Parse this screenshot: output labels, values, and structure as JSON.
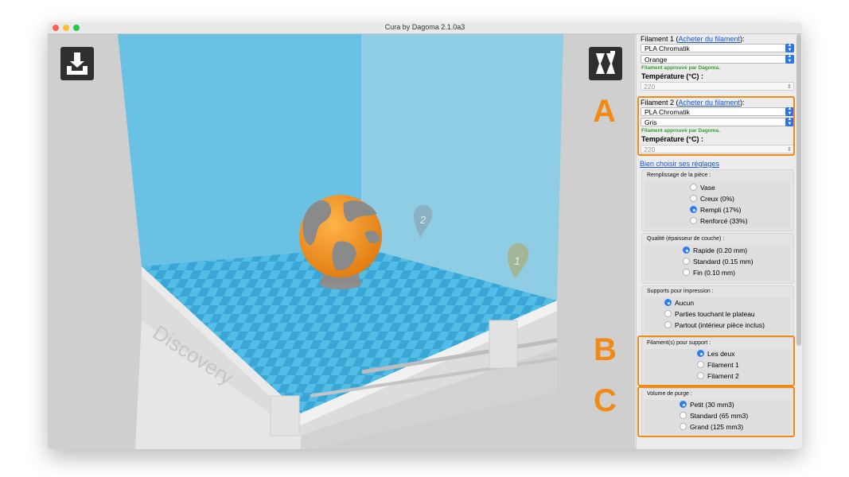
{
  "window": {
    "title": "Cura by Dagoma 2.1.0a3"
  },
  "viewport": {
    "bed_text": "Discovery",
    "markers": [
      "1",
      "2"
    ]
  },
  "filament1": {
    "label": "Filament  1 (",
    "buy_link": "Acheter du filament",
    "label_end": "):",
    "material": "PLA Chromatik",
    "color": "Orange",
    "approved": "Filament approuvé par Dagoma.",
    "temp_label": "Température (°C) :",
    "temp_value": "220"
  },
  "filament2": {
    "label": "Filament  2 (",
    "buy_link": "Acheter du filament",
    "label_end": "):",
    "material": "PLA Chromatik",
    "color": "Gris",
    "approved": "Filament approuvé par Dagoma.",
    "temp_label": "Température (°C) :",
    "temp_value": "220"
  },
  "settings_link": "Bien choisir ses réglages",
  "infill": {
    "title": "Remplissage de la pièce :",
    "options": [
      "Vase",
      "Creux (0%)",
      "Rempli (17%)",
      "Renforcé (33%)"
    ],
    "selected": "Rempli (17%)"
  },
  "quality": {
    "title": "Qualité (épaisseur de couche) :",
    "options": [
      "Rapide (0.20 mm)",
      "Standard (0.15 mm)",
      "Fin (0.10 mm)"
    ],
    "selected": "Rapide (0.20 mm)"
  },
  "supports": {
    "title": "Supports pour impression :",
    "options": [
      "Aucun",
      "Parties touchant le plateau",
      "Partout (intérieur pièce inclus)"
    ],
    "selected": "Aucun"
  },
  "support_filament": {
    "title": "Filament(s) pour support :",
    "options": [
      "Les deux",
      "Filament 1",
      "Filament 2"
    ],
    "selected": "Les deux"
  },
  "purge": {
    "title": "Volume de purge :",
    "options": [
      "Petit (30 mm3)",
      "Standard (65 mm3)",
      "Grand (125 mm3)"
    ],
    "selected": "Petit (30 mm3)"
  },
  "annotations": [
    "A",
    "B",
    "C"
  ],
  "colors": {
    "accent": "#f28a17",
    "link": "#1a55d8",
    "approved": "#3a9b36",
    "radio_selected": "#2e7cf6",
    "bed": "#4ab3e0"
  }
}
